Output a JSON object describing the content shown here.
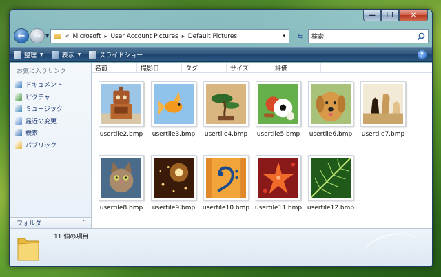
{
  "window": {
    "caption": {
      "minimize": "—",
      "maximize": "❐",
      "close": "✕"
    }
  },
  "address_bar": {
    "chevron": "«",
    "crumbs": [
      "Microsoft",
      "User Account Pictures",
      "Default Pictures"
    ],
    "separator": "▸",
    "dropdown": "▾"
  },
  "search": {
    "placeholder": "検索"
  },
  "toolbar": {
    "organize": "整理",
    "views": "表示",
    "slideshow": "スライドショー",
    "help": "?",
    "arrow": "▼"
  },
  "nav_pane": {
    "title": "お気に入りリンク",
    "items": [
      {
        "label": "ドキュメント",
        "icon": "documents-icon",
        "color": "#3c7fc4"
      },
      {
        "label": "ピクチャ",
        "icon": "pictures-icon",
        "color": "#4f9c4a"
      },
      {
        "label": "ミュージック",
        "icon": "music-icon",
        "color": "#3d86b8"
      },
      {
        "label": "最近の変更",
        "icon": "recent-icon",
        "color": "#5c8ccf"
      },
      {
        "label": "検索",
        "icon": "search-icon",
        "color": "#3a74b8"
      },
      {
        "label": "パブリック",
        "icon": "folder-icon",
        "color": "#e6b53f"
      }
    ],
    "folders_label": "フォルダ",
    "folders_chevron": "⌃"
  },
  "columns": [
    {
      "label": "名前",
      "width": 66
    },
    {
      "label": "撮影日",
      "width": 65
    },
    {
      "label": "タグ",
      "width": 65
    },
    {
      "label": "サイズ",
      "width": 65
    },
    {
      "label": "評価",
      "width": 72
    }
  ],
  "sort_indicator": "^",
  "files": [
    {
      "name": "usertile2.bmp",
      "subject": "robot"
    },
    {
      "name": "usertile3.bmp",
      "subject": "goldfish"
    },
    {
      "name": "usertile4.bmp",
      "subject": "bonsai"
    },
    {
      "name": "usertile5.bmp",
      "subject": "sports-balls"
    },
    {
      "name": "usertile6.bmp",
      "subject": "dog"
    },
    {
      "name": "usertile7.bmp",
      "subject": "chess"
    },
    {
      "name": "usertile8.bmp",
      "subject": "kitten"
    },
    {
      "name": "usertile9.bmp",
      "subject": "sparkles"
    },
    {
      "name": "usertile10.bmp",
      "subject": "bass-clef"
    },
    {
      "name": "usertile11.bmp",
      "subject": "starfish"
    },
    {
      "name": "usertile12.bmp",
      "subject": "leaf"
    }
  ],
  "details": {
    "count_text": "11 個の項目"
  }
}
